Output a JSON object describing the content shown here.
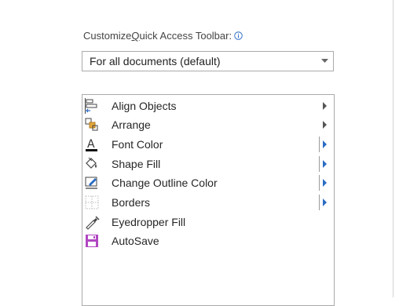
{
  "header": {
    "label_pre": "Customize ",
    "label_underlined": "Q",
    "label_post": "uick Access Toolbar:",
    "info_icon": "info-icon"
  },
  "scope_dropdown": {
    "value": "For all documents (default)"
  },
  "commands": [
    {
      "label": "Align Objects",
      "icon": "align-objects-icon",
      "submenu": true,
      "split": false
    },
    {
      "label": "Arrange",
      "icon": "arrange-icon",
      "submenu": true,
      "split": false
    },
    {
      "label": "Font Color",
      "icon": "font-color-icon",
      "submenu": true,
      "split": true
    },
    {
      "label": "Shape Fill",
      "icon": "shape-fill-icon",
      "submenu": true,
      "split": true
    },
    {
      "label": "Change Outline Color",
      "icon": "outline-color-icon",
      "submenu": true,
      "split": true
    },
    {
      "label": "Borders",
      "icon": "borders-icon",
      "submenu": true,
      "split": true
    },
    {
      "label": "Eyedropper Fill",
      "icon": "eyedropper-icon",
      "submenu": false,
      "split": false
    },
    {
      "label": "AutoSave",
      "icon": "autosave-icon",
      "submenu": false,
      "split": false
    }
  ],
  "colors": {
    "accent_blue": "#2b6cc4",
    "autosave_purple": "#b146c2",
    "arrange_orange": "#e8a93c"
  }
}
